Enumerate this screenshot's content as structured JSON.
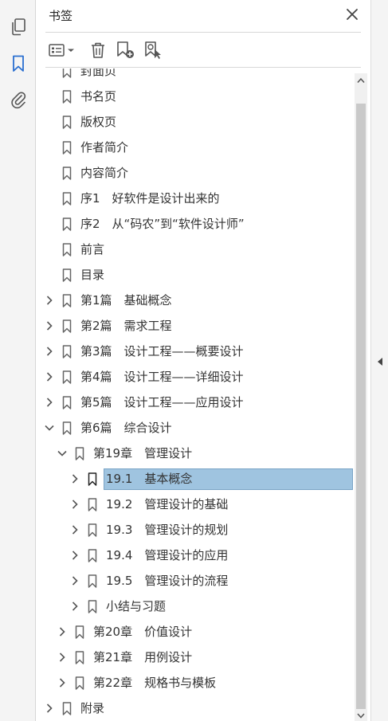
{
  "panel": {
    "title": "书签"
  },
  "rail": {
    "items": [
      {
        "name": "pages-icon"
      },
      {
        "name": "bookmarks-icon",
        "active": true
      },
      {
        "name": "attachments-icon"
      }
    ]
  },
  "toolbar": {
    "items": [
      "options-menu-icon",
      "delete-bookmark-icon",
      "new-bookmark-icon",
      "new-bookmark-from-structure-icon"
    ]
  },
  "tree": {
    "rows": [
      {
        "label": "封面页",
        "level": 0,
        "expand": "none",
        "partial": true
      },
      {
        "label": "书名页",
        "level": 0,
        "expand": "none"
      },
      {
        "label": "版权页",
        "level": 0,
        "expand": "none"
      },
      {
        "label": "作者简介",
        "level": 0,
        "expand": "none"
      },
      {
        "label": "内容简介",
        "level": 0,
        "expand": "none"
      },
      {
        "label": "序1　好软件是设计出来的",
        "level": 0,
        "expand": "none"
      },
      {
        "label": "序2　从“码农”到“软件设计师”",
        "level": 0,
        "expand": "none"
      },
      {
        "label": "前言",
        "level": 0,
        "expand": "none"
      },
      {
        "label": "目录",
        "level": 0,
        "expand": "none"
      },
      {
        "label": "第1篇　基础概念",
        "level": 0,
        "expand": "collapsed"
      },
      {
        "label": "第2篇　需求工程",
        "level": 0,
        "expand": "collapsed"
      },
      {
        "label": "第3篇　设计工程——概要设计",
        "level": 0,
        "expand": "collapsed"
      },
      {
        "label": "第4篇　设计工程——详细设计",
        "level": 0,
        "expand": "collapsed"
      },
      {
        "label": "第5篇　设计工程——应用设计",
        "level": 0,
        "expand": "collapsed"
      },
      {
        "label": "第6篇　综合设计",
        "level": 0,
        "expand": "expanded"
      },
      {
        "label": "第19章　管理设计",
        "level": 1,
        "expand": "expanded"
      },
      {
        "label": "19.1　基本概念",
        "level": 2,
        "expand": "collapsed",
        "selected": true
      },
      {
        "label": "19.2　管理设计的基础",
        "level": 2,
        "expand": "collapsed"
      },
      {
        "label": "19.3　管理设计的规划",
        "level": 2,
        "expand": "collapsed"
      },
      {
        "label": "19.4　管理设计的应用",
        "level": 2,
        "expand": "collapsed"
      },
      {
        "label": "19.5　管理设计的流程",
        "level": 2,
        "expand": "collapsed"
      },
      {
        "label": "小结与习题",
        "level": 2,
        "expand": "collapsed"
      },
      {
        "label": "第20章　价值设计",
        "level": 1,
        "expand": "collapsed"
      },
      {
        "label": "第21章　用例设计",
        "level": 1,
        "expand": "collapsed"
      },
      {
        "label": "第22章　规格书与模板",
        "level": 1,
        "expand": "collapsed"
      },
      {
        "label": "附录",
        "level": 0,
        "expand": "collapsed"
      }
    ]
  },
  "colors": {
    "accent": "#2a6fd0",
    "selection": "#9fc4e0",
    "icon": "#555555"
  }
}
